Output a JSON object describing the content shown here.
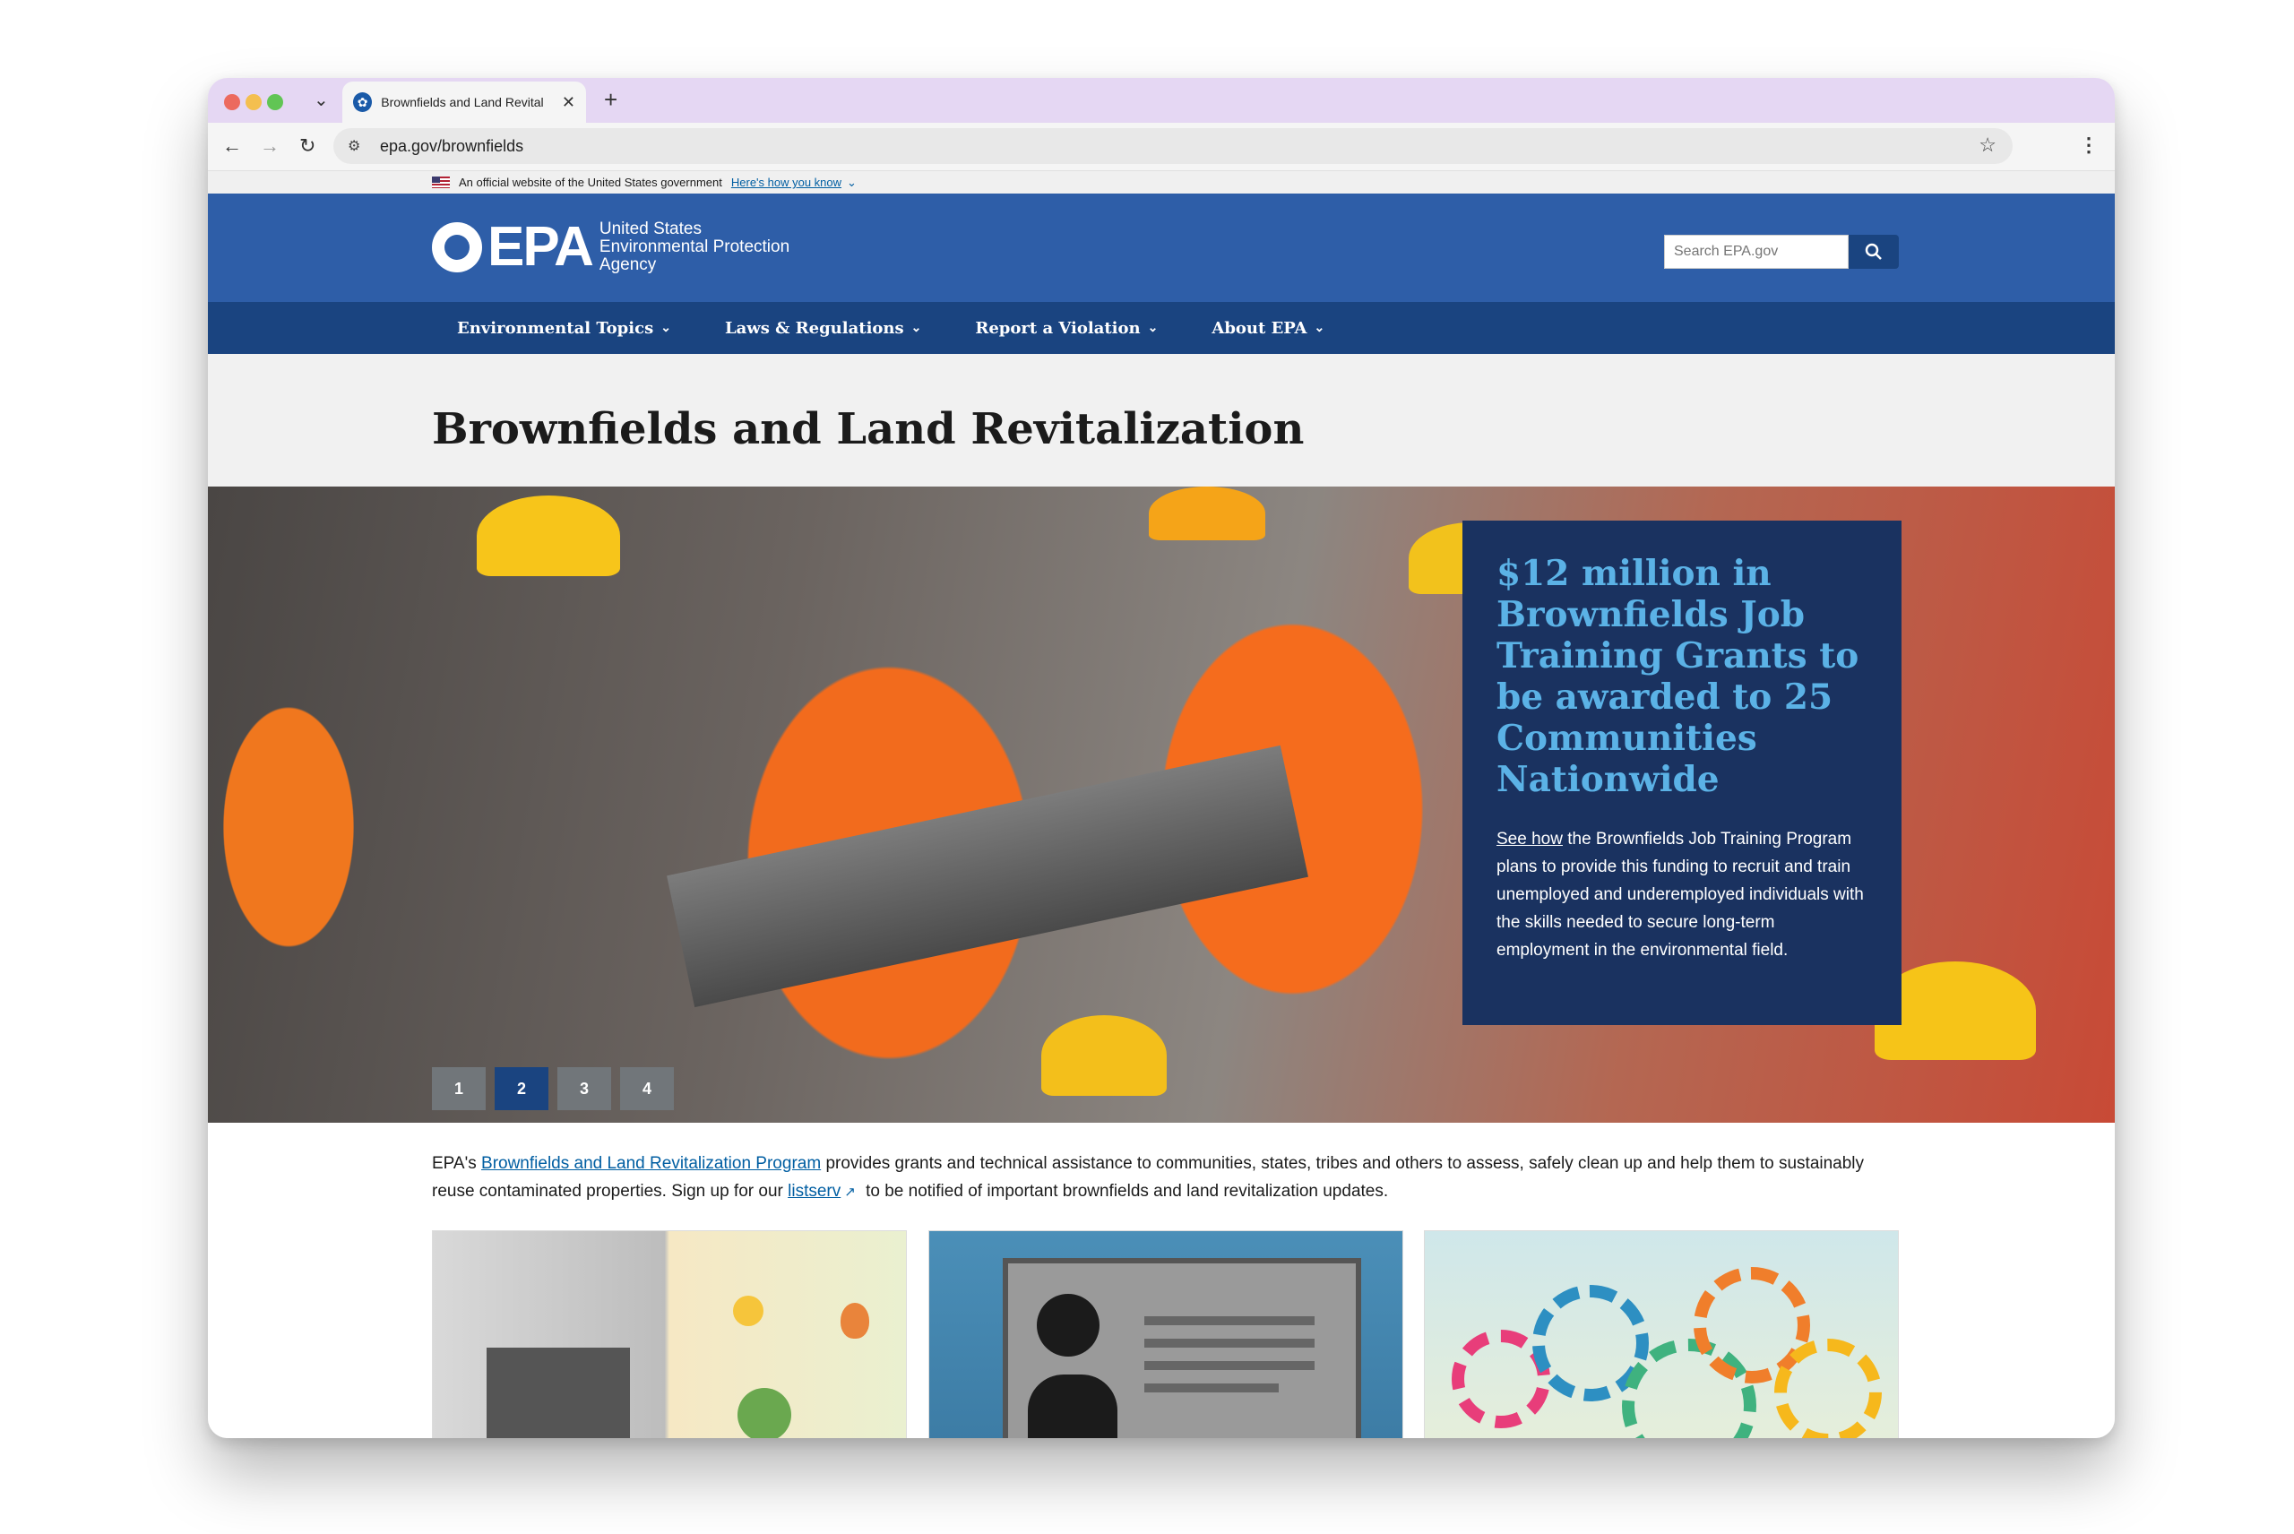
{
  "browser": {
    "tab_title": "Brownfields and Land Revital",
    "url": "epa.gov/brownfields",
    "new_tab": "+",
    "close": "✕"
  },
  "gov_banner": {
    "text": "An official website of the United States government",
    "link": "Here's how you know",
    "chevron": "⌄"
  },
  "header": {
    "logo_text": "EPA",
    "agency_line1": "United States",
    "agency_line2": "Environmental Protection",
    "agency_line3": "Agency",
    "search_placeholder": "Search EPA.gov"
  },
  "nav": {
    "items": [
      {
        "label": "Environmental Topics"
      },
      {
        "label": "Laws & Regulations"
      },
      {
        "label": "Report a Violation"
      },
      {
        "label": "About EPA"
      }
    ],
    "caret": "⌄"
  },
  "page": {
    "title": "Brownfields and Land Revitalization"
  },
  "hero": {
    "headline": "$12 million in Brownfields Job Training Grants to be awarded to 25 Communities Nationwide",
    "link": "See how",
    "body": " the Brownfields Job Training Program plans to provide this funding to recruit and train unemployed and underemployed individuals with the skills needed to secure long-term employment in the environmental field.",
    "pager": [
      "1",
      "2",
      "3",
      "4"
    ],
    "active_page": "2"
  },
  "intro": {
    "prefix": "EPA's ",
    "program_link": "Brownfields and Land Revitalization Program",
    "middle": " provides grants and technical assistance to communities, states, tribes and others to assess, safely clean up and help them to sustainably reuse contaminated properties. Sign up for our ",
    "listserv_link": "listserv",
    "suffix": " to be notified of important brownfields and land revitalization updates."
  },
  "colors": {
    "header_blue": "#2e5ea8",
    "nav_blue": "#1a4480",
    "hero_card": "#1a3260",
    "hero_headline": "#5bb2e6",
    "link": "#005ea2"
  },
  "icons": [
    "site-info-icon",
    "search-icon",
    "star-icon",
    "external-link-icon",
    "flag-icon",
    "epa-logo-icon"
  ]
}
